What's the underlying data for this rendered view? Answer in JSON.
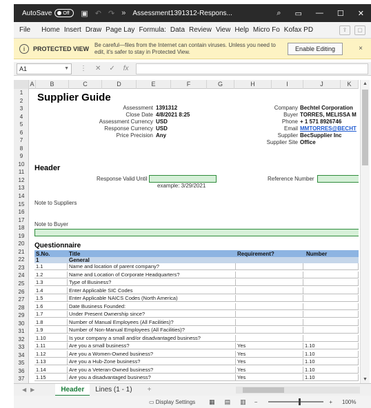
{
  "titlebar": {
    "autosave_label": "AutoSave",
    "autosave_state": "Off",
    "document_title": "Assessment1391312-Respons..."
  },
  "ribbon": {
    "tabs": [
      "File",
      "Home",
      "Insert",
      "Draw",
      "Page Lay",
      "Formula:",
      "Data",
      "Review",
      "View",
      "Help",
      "Micro Fo",
      "Kofax PD"
    ]
  },
  "protected_view": {
    "title": "PROTECTED VIEW",
    "message": "Be careful—files from the Internet can contain viruses. Unless you need to edit, it's safer to stay in Protected View.",
    "enable_button": "Enable Editing",
    "close": "×"
  },
  "formula_bar": {
    "name_box": "A1",
    "fx": "fx",
    "value": ""
  },
  "columns": [
    "A",
    "B",
    "C",
    "D",
    "E",
    "F",
    "G",
    "H",
    "I",
    "J",
    "K"
  ],
  "rows": [
    "1",
    "2",
    "3",
    "4",
    "5",
    "6",
    "7",
    "8",
    "9",
    "10",
    "11",
    "12",
    "13",
    "14",
    "15",
    "16",
    "17",
    "18",
    "19",
    "20",
    "21",
    "22",
    "23",
    "24",
    "25",
    "26",
    "27",
    "28",
    "29",
    "30",
    "31",
    "32",
    "33",
    "34",
    "35",
    "36",
    "37"
  ],
  "sheet": {
    "title": "Supplier Guide",
    "left_info": [
      {
        "label": "Assessment",
        "value": "1391312"
      },
      {
        "label": "Close Date",
        "value": "4/8/2021 8:25"
      },
      {
        "label": "Assessment Currency",
        "value": "USD"
      },
      {
        "label": "Response Currency",
        "value": "USD"
      },
      {
        "label": "Price Precision",
        "value": "Any"
      }
    ],
    "right_info": [
      {
        "label": "Company",
        "value": "Bechtel Corporation"
      },
      {
        "label": "Buyer",
        "value": "TORRES, MELISSA M"
      },
      {
        "label": "Phone",
        "value": "+ 1 571 8926746"
      },
      {
        "label": "Email",
        "value": "MMTORRES@BECHT"
      },
      {
        "label": "Supplier",
        "value": "BecSupplier Inc"
      },
      {
        "label": "Supplier Site",
        "value": "Office"
      }
    ],
    "header_section": "Header",
    "response_valid_until_label": "Response Valid Until",
    "example_text": "example:  3/29/2021",
    "reference_number_label": "Reference Number",
    "note_to_suppliers": "Note to Suppliers",
    "note_to_buyer": "Note to Buyer",
    "questionnaire_section": "Questionnaire"
  },
  "table": {
    "headers": [
      "S.No.",
      "Title",
      "Requirement?",
      "Number"
    ],
    "group": {
      "sno": "1",
      "title": "General"
    },
    "rows": [
      {
        "sno": "1.1",
        "title": "Name and location of parent company?",
        "req": "",
        "num": ""
      },
      {
        "sno": "1.2",
        "title": "Name and Location of Corporate Headquarters?",
        "req": "",
        "num": ""
      },
      {
        "sno": "1.3",
        "title": "Type of Business?",
        "req": "",
        "num": ""
      },
      {
        "sno": "1.4",
        "title": "Enter Applicable SIC Codes",
        "req": "",
        "num": ""
      },
      {
        "sno": "1.5",
        "title": "Enter Applicable NAICS Codes (North America)",
        "req": "",
        "num": ""
      },
      {
        "sno": "1.6",
        "title": "Date Business Founded:",
        "req": "",
        "num": ""
      },
      {
        "sno": "1.7",
        "title": "Under  Present Ownership since?",
        "req": "",
        "num": ""
      },
      {
        "sno": "1.8",
        "title": "Number of Manual Employees (All Facilities)?",
        "req": "",
        "num": ""
      },
      {
        "sno": "1.9",
        "title": "Number of Non-Manual Employees (All Facilities)?",
        "req": "",
        "num": ""
      },
      {
        "sno": "1.10",
        "title": "Is your company a small and/or disadvantaged business?",
        "req": "",
        "num": ""
      },
      {
        "sno": "1.11",
        "title": "Are you a small business?",
        "req": "Yes",
        "num": "1.10"
      },
      {
        "sno": "1.12",
        "title": "Are you a Women-Owned business?",
        "req": "Yes",
        "num": "1.10"
      },
      {
        "sno": "1.13",
        "title": "Are you a Hub-Zone business?",
        "req": "Yes",
        "num": "1.10"
      },
      {
        "sno": "1.14",
        "title": "Are you a Veteran-Owned business?",
        "req": "Yes",
        "num": "1.10"
      },
      {
        "sno": "1.15",
        "title": "Are you a disadvantaged business?",
        "req": "Yes",
        "num": "1.10"
      }
    ]
  },
  "sheet_tabs": {
    "tabs": [
      "Header",
      "Lines (1 - 1)"
    ],
    "active": "Header",
    "add": "+"
  },
  "status": {
    "display_settings": "Display Settings",
    "zoom_minus": "−",
    "zoom_plus": "+",
    "zoom": "100%"
  }
}
